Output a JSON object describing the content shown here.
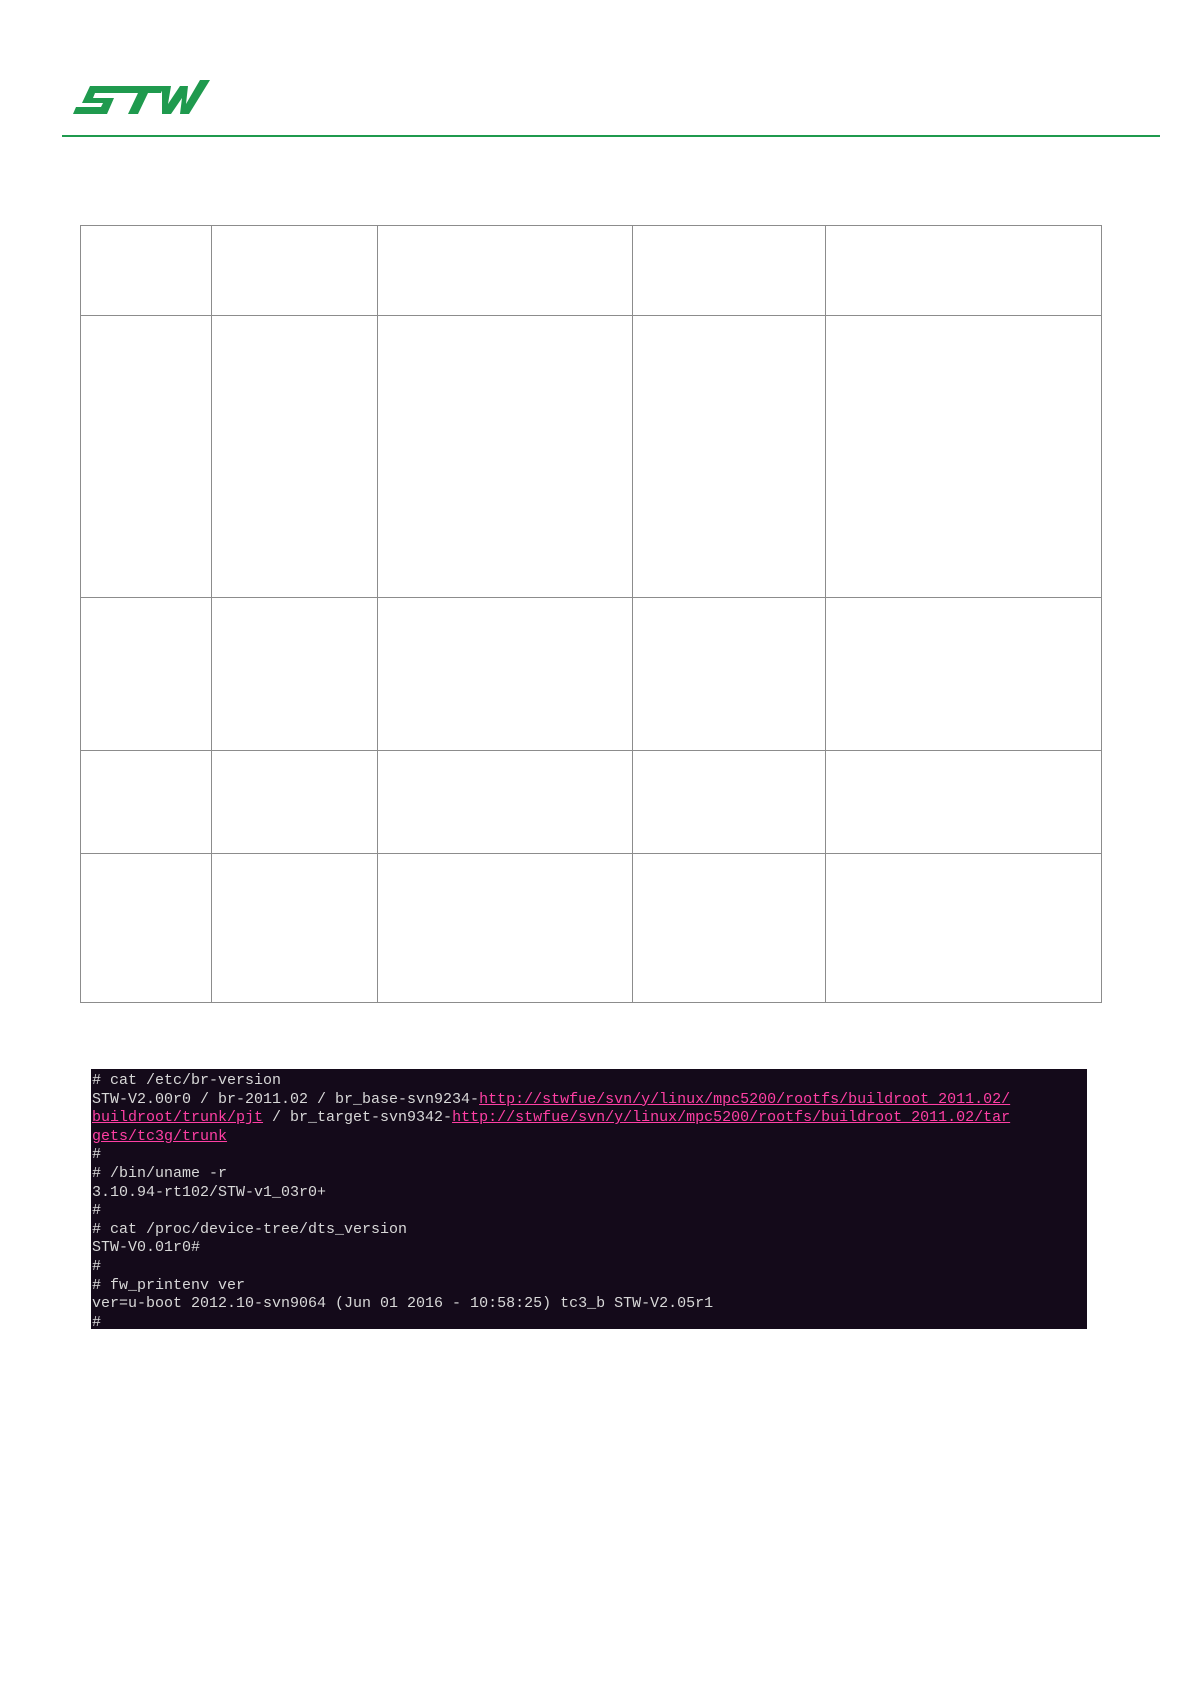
{
  "header": {
    "logo_text": "STW",
    "brand_color": "#1f9a4e"
  },
  "table": {
    "columns": 5,
    "rows": 6,
    "cells_text": ""
  },
  "terminal": {
    "background": "#140a1a",
    "link_color": "#ff3fa4",
    "lines": [
      {
        "parts": [
          {
            "text": "# cat /etc/br-version"
          }
        ]
      },
      {
        "parts": [
          {
            "text": "STW-V2.00r0 / br-2011.02 / br_base-svn9234-"
          },
          {
            "text": "http://stwfue/svn/y/linux/mpc5200/rootfs/buildroot_2011.02/",
            "link": true
          }
        ]
      },
      {
        "parts": [
          {
            "text": "buildroot/trunk/pjt",
            "link": true
          },
          {
            "text": " / br_target-svn9342-"
          },
          {
            "text": "http://stwfue/svn/y/linux/mpc5200/rootfs/buildroot_2011.02/tar",
            "link": true
          }
        ]
      },
      {
        "parts": [
          {
            "text": "gets/tc3g/trunk",
            "link": true
          }
        ]
      },
      {
        "parts": [
          {
            "text": "#"
          }
        ]
      },
      {
        "parts": [
          {
            "text": "# /bin/uname -r"
          }
        ]
      },
      {
        "parts": [
          {
            "text": "3.10.94-rt102/STW-v1_03r0+"
          }
        ]
      },
      {
        "parts": [
          {
            "text": "#"
          }
        ]
      },
      {
        "parts": [
          {
            "text": "# cat /proc/device-tree/dts_version"
          }
        ]
      },
      {
        "parts": [
          {
            "text": "STW-V0.01r0#"
          }
        ]
      },
      {
        "parts": [
          {
            "text": "#"
          }
        ]
      },
      {
        "parts": [
          {
            "text": "# fw_printenv ver"
          }
        ]
      },
      {
        "parts": [
          {
            "text": "ver=u-boot 2012.10-svn9064 (Jun 01 2016 - 10:58:25) tc3_b STW-V2.05r1"
          }
        ]
      },
      {
        "parts": [
          {
            "text": "#"
          }
        ]
      }
    ]
  }
}
